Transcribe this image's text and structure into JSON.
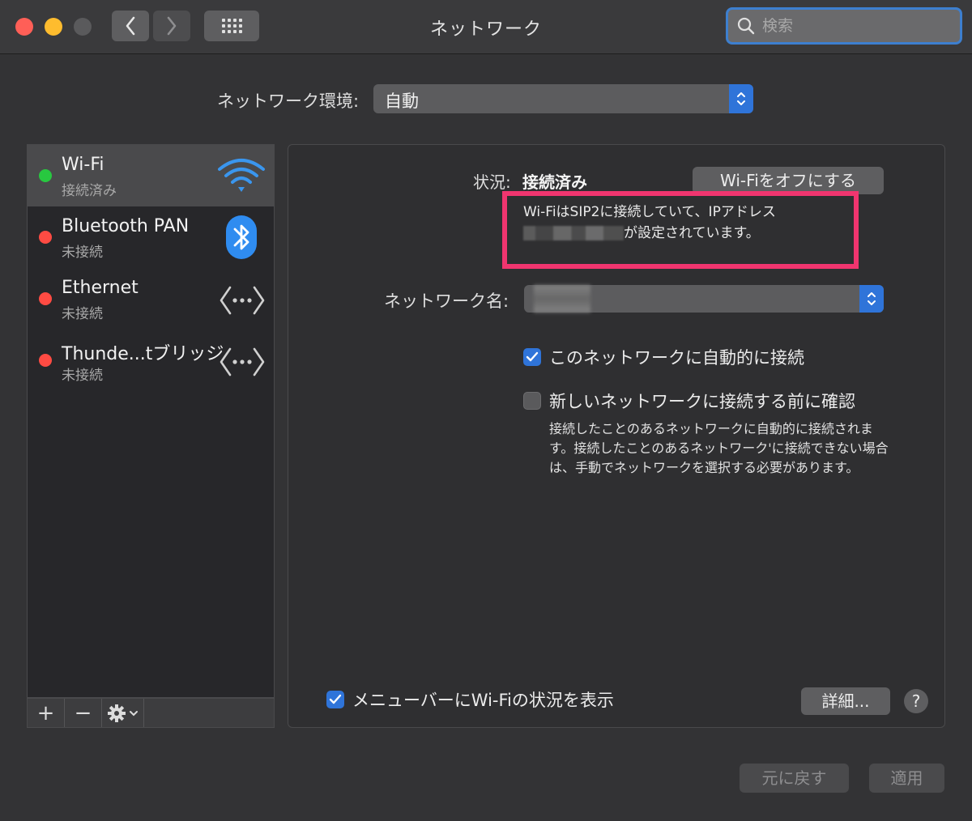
{
  "window": {
    "title": "ネットワーク",
    "search_placeholder": "検索"
  },
  "location": {
    "label": "ネットワーク環境:",
    "value": "自動"
  },
  "services": [
    {
      "name": "Wi-Fi",
      "status": "接続済み",
      "dot_color": "#28c840",
      "icon": "wifi-icon"
    },
    {
      "name": "Bluetooth PAN",
      "status": "未接続",
      "dot_color": "#ff4b43",
      "icon": "bluetooth-icon"
    },
    {
      "name": "Ethernet",
      "status": "未接続",
      "dot_color": "#ff4b43",
      "icon": "ethernet-arrows-icon"
    },
    {
      "name": "Thunde...tブリッジ",
      "status": "未接続",
      "dot_color": "#ff4b43",
      "icon": "ethernet-arrows-icon"
    }
  ],
  "sidebar_tools": {
    "add": "+",
    "remove": "−"
  },
  "detail": {
    "status_label": "状況:",
    "status_value": "接続済み",
    "wifi_off_button": "Wi-Fiをオフにする",
    "status_desc_line1": "Wi-FiはSIP2に接続していて、IPアドレス",
    "status_desc_line2_suffix": "が設定されています。",
    "network_name_label": "ネットワーク名:",
    "auto_join_label": "このネットワークに自動的に接続",
    "auto_join_checked": true,
    "ask_join_label": "新しいネットワークに接続する前に確認",
    "ask_join_checked": false,
    "ask_join_help": "接続したことのあるネットワークに自動的に接続されます。接続したことのあるネットワーク'に接続できない場合は、手動でネットワークを選択する必要があります。",
    "menubar_label": "メニューバーにWi-Fiの状況を表示",
    "menubar_checked": true,
    "advanced_button": "詳細...",
    "help_button": "?"
  },
  "footer": {
    "revert_button": "元に戻す",
    "apply_button": "適用"
  },
  "colors": {
    "accent": "#2f74d9",
    "highlight_box": "#f0356f",
    "connected": "#28c840",
    "disconnected": "#ff4b43"
  }
}
